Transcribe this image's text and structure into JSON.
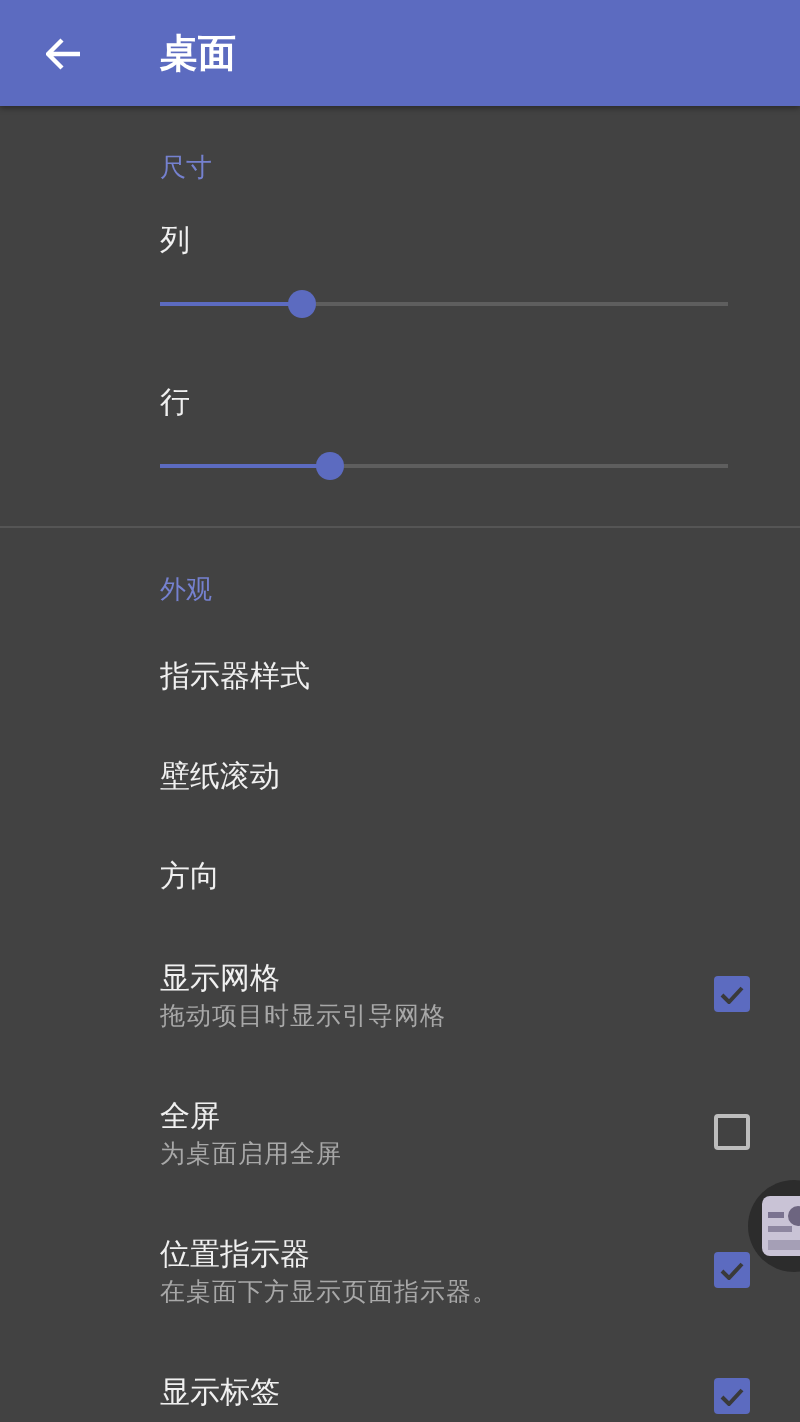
{
  "app_bar": {
    "title": "桌面"
  },
  "sections": [
    {
      "header": "尺寸",
      "items": [
        {
          "kind": "slider",
          "title": "列",
          "level": 0.25
        },
        {
          "kind": "slider",
          "title": "行",
          "level": 0.3
        }
      ]
    },
    {
      "header": "外观",
      "items": [
        {
          "kind": "plain",
          "title": "指示器样式"
        },
        {
          "kind": "plain",
          "title": "壁纸滚动"
        },
        {
          "kind": "plain",
          "title": "方向"
        },
        {
          "kind": "checkbox",
          "title": "显示网格",
          "subtitle": "拖动项目时显示引导网格",
          "checked": true
        },
        {
          "kind": "checkbox",
          "title": "全屏",
          "subtitle": "为桌面启用全屏",
          "checked": false
        },
        {
          "kind": "checkbox",
          "title": "位置指示器",
          "subtitle": "在桌面下方显示页面指示器。",
          "checked": true
        },
        {
          "kind": "checkbox",
          "title": "显示标签",
          "checked": true
        }
      ]
    }
  ]
}
